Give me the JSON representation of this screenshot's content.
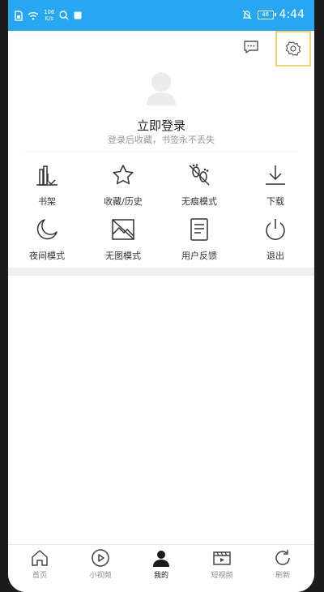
{
  "status_bar": {
    "net_speed_value": "106",
    "net_speed_unit": "K/s",
    "battery": "46",
    "time": "4:44"
  },
  "profile": {
    "title": "立即登录",
    "subtitle": "登录后收藏，书签永不丢失"
  },
  "grid": [
    {
      "label": "书架",
      "icon": "bookshelf-icon"
    },
    {
      "label": "收藏/历史",
      "icon": "star-icon"
    },
    {
      "label": "无痕模式",
      "icon": "footprint-off-icon"
    },
    {
      "label": "下载",
      "icon": "download-icon"
    },
    {
      "label": "夜间模式",
      "icon": "moon-icon"
    },
    {
      "label": "无图模式",
      "icon": "no-image-icon"
    },
    {
      "label": "用户反馈",
      "icon": "feedback-icon"
    },
    {
      "label": "退出",
      "icon": "power-icon"
    }
  ],
  "bottom_nav": [
    {
      "label": "首页",
      "icon": "home-icon"
    },
    {
      "label": "小视频",
      "icon": "play-icon"
    },
    {
      "label": "我的",
      "icon": "person-icon",
      "active": true
    },
    {
      "label": "短视频",
      "icon": "clapper-icon"
    },
    {
      "label": "刷新",
      "icon": "refresh-icon"
    }
  ],
  "colors": {
    "status_bar": "#27a7f2",
    "settings_highlight": "#f5d16a"
  }
}
